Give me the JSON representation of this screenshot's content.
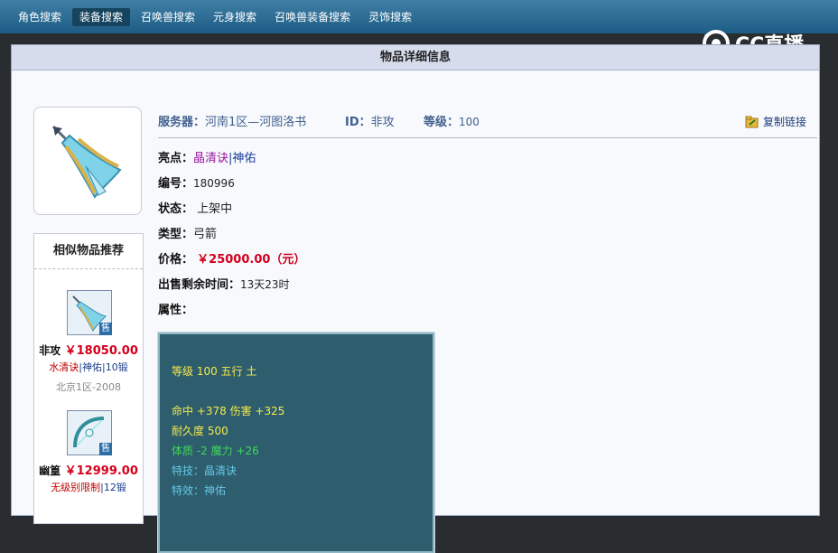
{
  "nav": {
    "items": [
      "角色搜索",
      "装备搜索",
      "召唤兽搜索",
      "元身搜索",
      "召唤兽装备搜索",
      "灵饰搜索"
    ],
    "active_index": 1
  },
  "logo": {
    "text": "CC直播"
  },
  "panel": {
    "title": "物品详细信息"
  },
  "header": {
    "server_label": "服务器：",
    "server_value": "河南1区—河图洛书",
    "id_label": "ID：",
    "id_value": "非攻",
    "level_label": "等级：",
    "level_value": "100",
    "copy_link": "复制链接"
  },
  "details": {
    "highlights_label": "亮点：",
    "highlight_1": "晶清诀",
    "separator": "|",
    "highlight_2": "神佑",
    "number_label": "编号：",
    "number_value": "180996",
    "status_label": "状态：",
    "status_value": "上架中",
    "type_label": "类型：",
    "type_value": "弓箭",
    "price_label": "价格：",
    "price_value": "￥25000.00（元）",
    "remaining_label": "出售剩余时间：",
    "remaining_value": "13天23时",
    "attributes_label": "属性："
  },
  "attributes": {
    "line1": "等级 100  五行 土",
    "line2": "命中 +378 伤害 +325",
    "line3": "耐久度 500",
    "line4": "体质 -2 魔力 +26",
    "line5": "特技：晶清诀",
    "line6": "特效：神佑"
  },
  "similar": {
    "title": "相似物品推荐",
    "badge": "售",
    "items": [
      {
        "name": "非攻",
        "price": "￥18050.00",
        "tag1": "水清诀",
        "sep": "|",
        "tag2": "神佑",
        "tag3": "|10锻",
        "server": "北京1区-2008"
      },
      {
        "name": "幽篁",
        "price": "￥12999.00",
        "tag1": "无级别限制",
        "sep": "|",
        "tag2": "12锻",
        "tag3": "",
        "server": ""
      }
    ]
  },
  "colors": {
    "accent_red": "#d4001c",
    "nav_bg": "#1d5c84",
    "attr_bg": "#2e5e6d"
  }
}
